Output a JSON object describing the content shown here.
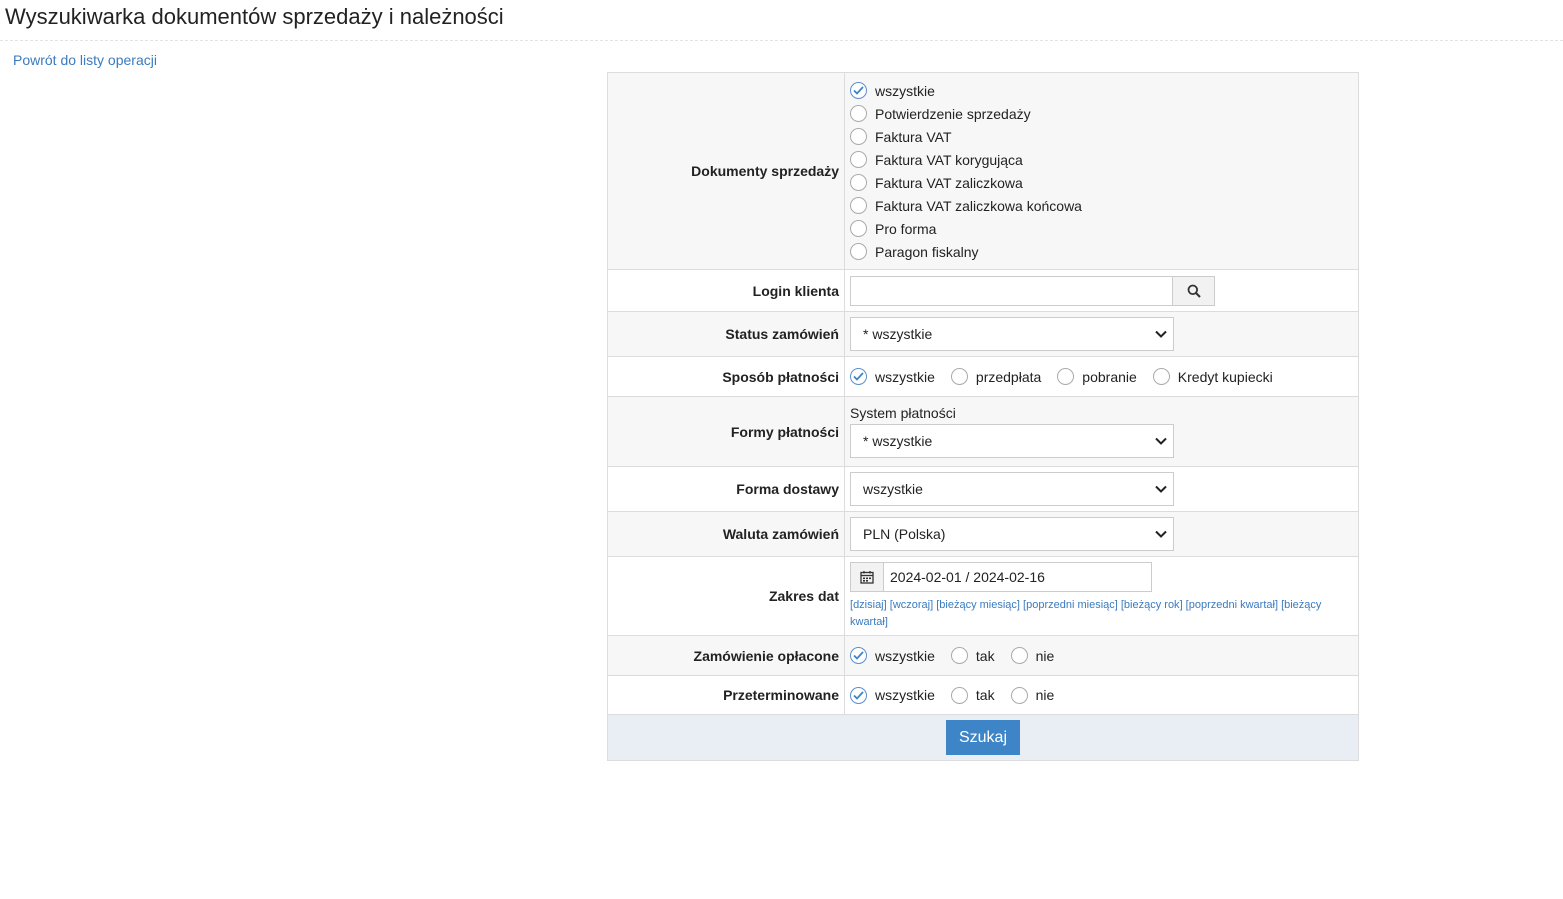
{
  "page": {
    "title": "Wyszukiwarka dokumentów sprzedaży i należności",
    "back_link": "Powrót do listy operacji"
  },
  "form": {
    "sales_docs": {
      "label": "Dokumenty sprzedaży",
      "options": [
        "wszystkie",
        "Potwierdzenie sprzedaży",
        "Faktura VAT",
        "Faktura VAT korygująca",
        "Faktura VAT zaliczkowa",
        "Faktura VAT zaliczkowa końcowa",
        "Pro forma",
        "Paragon fiskalny"
      ],
      "selected": "wszystkie"
    },
    "client_login": {
      "label": "Login klienta",
      "value": ""
    },
    "order_status": {
      "label": "Status zamówień",
      "value": "* wszystkie"
    },
    "payment_method": {
      "label": "Sposób płatności",
      "options": [
        "wszystkie",
        "przedpłata",
        "pobranie",
        "Kredyt kupiecki"
      ],
      "selected": "wszystkie"
    },
    "payment_forms": {
      "label": "Formy płatności",
      "sublabel": "System płatności",
      "value": "* wszystkie"
    },
    "delivery": {
      "label": "Forma dostawy",
      "value": "wszystkie"
    },
    "currency": {
      "label": "Waluta zamówień",
      "value": "PLN (Polska)"
    },
    "date_range": {
      "label": "Zakres dat",
      "value": "2024-02-01 / 2024-02-16",
      "quick_links": [
        "dzisiaj",
        "wczoraj",
        "bieżący miesiąc",
        "poprzedni miesiąc",
        "bieżący rok",
        "poprzedni kwartał",
        "bieżący kwartał"
      ]
    },
    "paid": {
      "label": "Zamówienie opłacone",
      "options": [
        "wszystkie",
        "tak",
        "nie"
      ],
      "selected": "wszystkie"
    },
    "overdue": {
      "label": "Przeterminowane",
      "options": [
        "wszystkie",
        "tak",
        "nie"
      ],
      "selected": "wszystkie"
    },
    "submit_label": "Szukaj"
  },
  "colors": {
    "accent": "#3d85c6",
    "link": "#3a7bbf",
    "footer_bg": "#e9eef4"
  },
  "icons": {
    "search": "search-icon",
    "calendar": "calendar-icon",
    "select_arrow": "chevron-down-icon"
  }
}
